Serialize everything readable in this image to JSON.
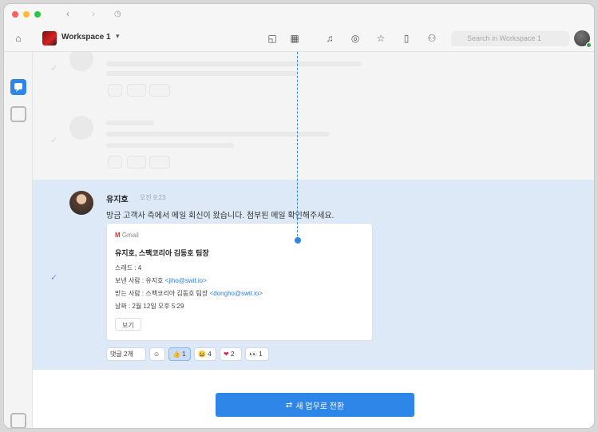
{
  "toolbar": {
    "workspace_name": "Workspace 1",
    "search_placeholder": "Search in Workspace 1"
  },
  "message": {
    "author": "유지호",
    "time": "오전 9:23",
    "text": "방금 고객사 측에서 메일 회신이 왔습니다. 첨부된 메일 확인해주세요."
  },
  "email_card": {
    "source": "Gmail",
    "title": "유지호, 스팩코리아 김동호 팀장",
    "line1": "스레드 : 4",
    "line2_prefix": "보낸 사람 : 유지호 ",
    "line2_link": "<jiho@swit.io>",
    "line3_prefix": "받는 사람 : 스팩코리아 김동호 팀장 ",
    "line3_link": "<dongho@swit.io>",
    "line4": "날짜 : 2월 12일 오후 5:29",
    "button_label": "보기"
  },
  "reactions": {
    "replies_label": "댓글 2개",
    "thumbs_count": "1",
    "smile_count": "4",
    "heart_count": "2",
    "eyes_count": "1"
  },
  "cta": {
    "label": "새 업무로 전환"
  },
  "colors": {
    "accent": "#2e86e8",
    "highlight": "#dde9f7",
    "online": "#2ea84a"
  }
}
